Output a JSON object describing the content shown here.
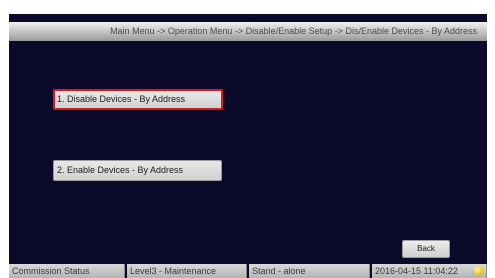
{
  "header": {
    "breadcrumb": "Main Menu -> Operation Menu -> Disable/Enable Setup -> Dis/Enable Devices - By Address"
  },
  "menu": {
    "items": [
      {
        "label": "1. Disable Devices - By Address",
        "selected": true
      },
      {
        "label": "2. Enable Devices - By Address",
        "selected": false
      }
    ]
  },
  "footer": {
    "back_label": "Back"
  },
  "status_bar": {
    "commission_status": "Commission Status",
    "access_level": "Level3 - Maintenance",
    "mode": "Stand - alone",
    "datetime": "2016-04-15 11:04:22",
    "indicator_color": "#f7d21a"
  },
  "colors": {
    "background": "#0c0a2a",
    "selected_border": "#d31c1c"
  }
}
